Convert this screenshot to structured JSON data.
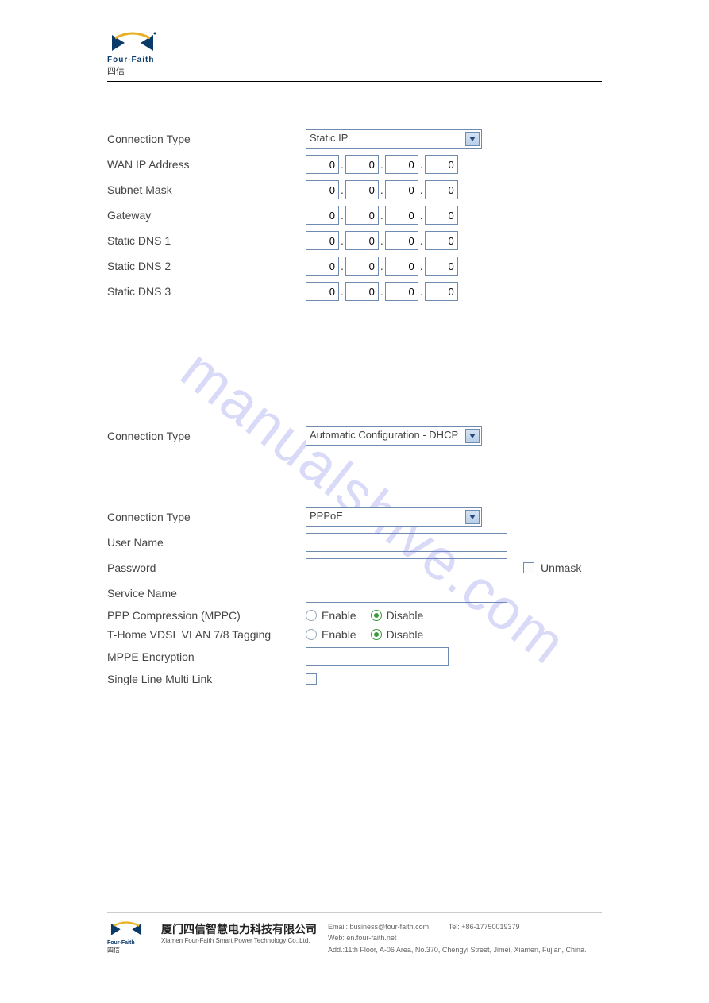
{
  "brand": {
    "name_en": "Four-Faith",
    "name_cn": "四信"
  },
  "watermark": "manualshive.com",
  "section1": {
    "connection_type_label": "Connection Type",
    "connection_type_value": "Static IP",
    "rows": [
      {
        "label": "WAN IP Address",
        "ip": [
          "0",
          "0",
          "0",
          "0"
        ]
      },
      {
        "label": "Subnet Mask",
        "ip": [
          "0",
          "0",
          "0",
          "0"
        ]
      },
      {
        "label": "Gateway",
        "ip": [
          "0",
          "0",
          "0",
          "0"
        ]
      },
      {
        "label": "Static DNS 1",
        "ip": [
          "0",
          "0",
          "0",
          "0"
        ]
      },
      {
        "label": "Static DNS 2",
        "ip": [
          "0",
          "0",
          "0",
          "0"
        ]
      },
      {
        "label": "Static DNS 3",
        "ip": [
          "0",
          "0",
          "0",
          "0"
        ]
      }
    ]
  },
  "section2": {
    "connection_type_label": "Connection Type",
    "connection_type_value": "Automatic Configuration - DHCP"
  },
  "section3": {
    "connection_type_label": "Connection Type",
    "connection_type_value": "PPPoE",
    "username_label": "User Name",
    "username_value": "",
    "password_label": "Password",
    "password_value": "",
    "unmask_label": "Unmask",
    "unmask_checked": false,
    "service_name_label": "Service Name",
    "service_name_value": "",
    "ppp_compression_label": "PPP Compression (MPPC)",
    "thome_label": "T-Home VDSL VLAN 7/8 Tagging",
    "radio_enable": "Enable",
    "radio_disable": "Disable",
    "ppp_compression_value": "Disable",
    "thome_value": "Disable",
    "mppe_label": "MPPE Encryption",
    "mppe_value": "",
    "single_line_label": "Single Line Multi Link",
    "single_line_checked": false
  },
  "footer": {
    "company_cn": "厦门四信智慧电力科技有限公司",
    "company_en": "Xiamen Four-Faith Smart Power Technology Co.,Ltd.",
    "email": "Email: business@four-faith.com",
    "tel": "Tel: +86-17750019379",
    "web": "Web: en.four-faith.net",
    "addr": "Add.:11th Floor, A-06 Area, No.370, Chengyi Street, Jimei, Xiamen, Fujian, China."
  }
}
